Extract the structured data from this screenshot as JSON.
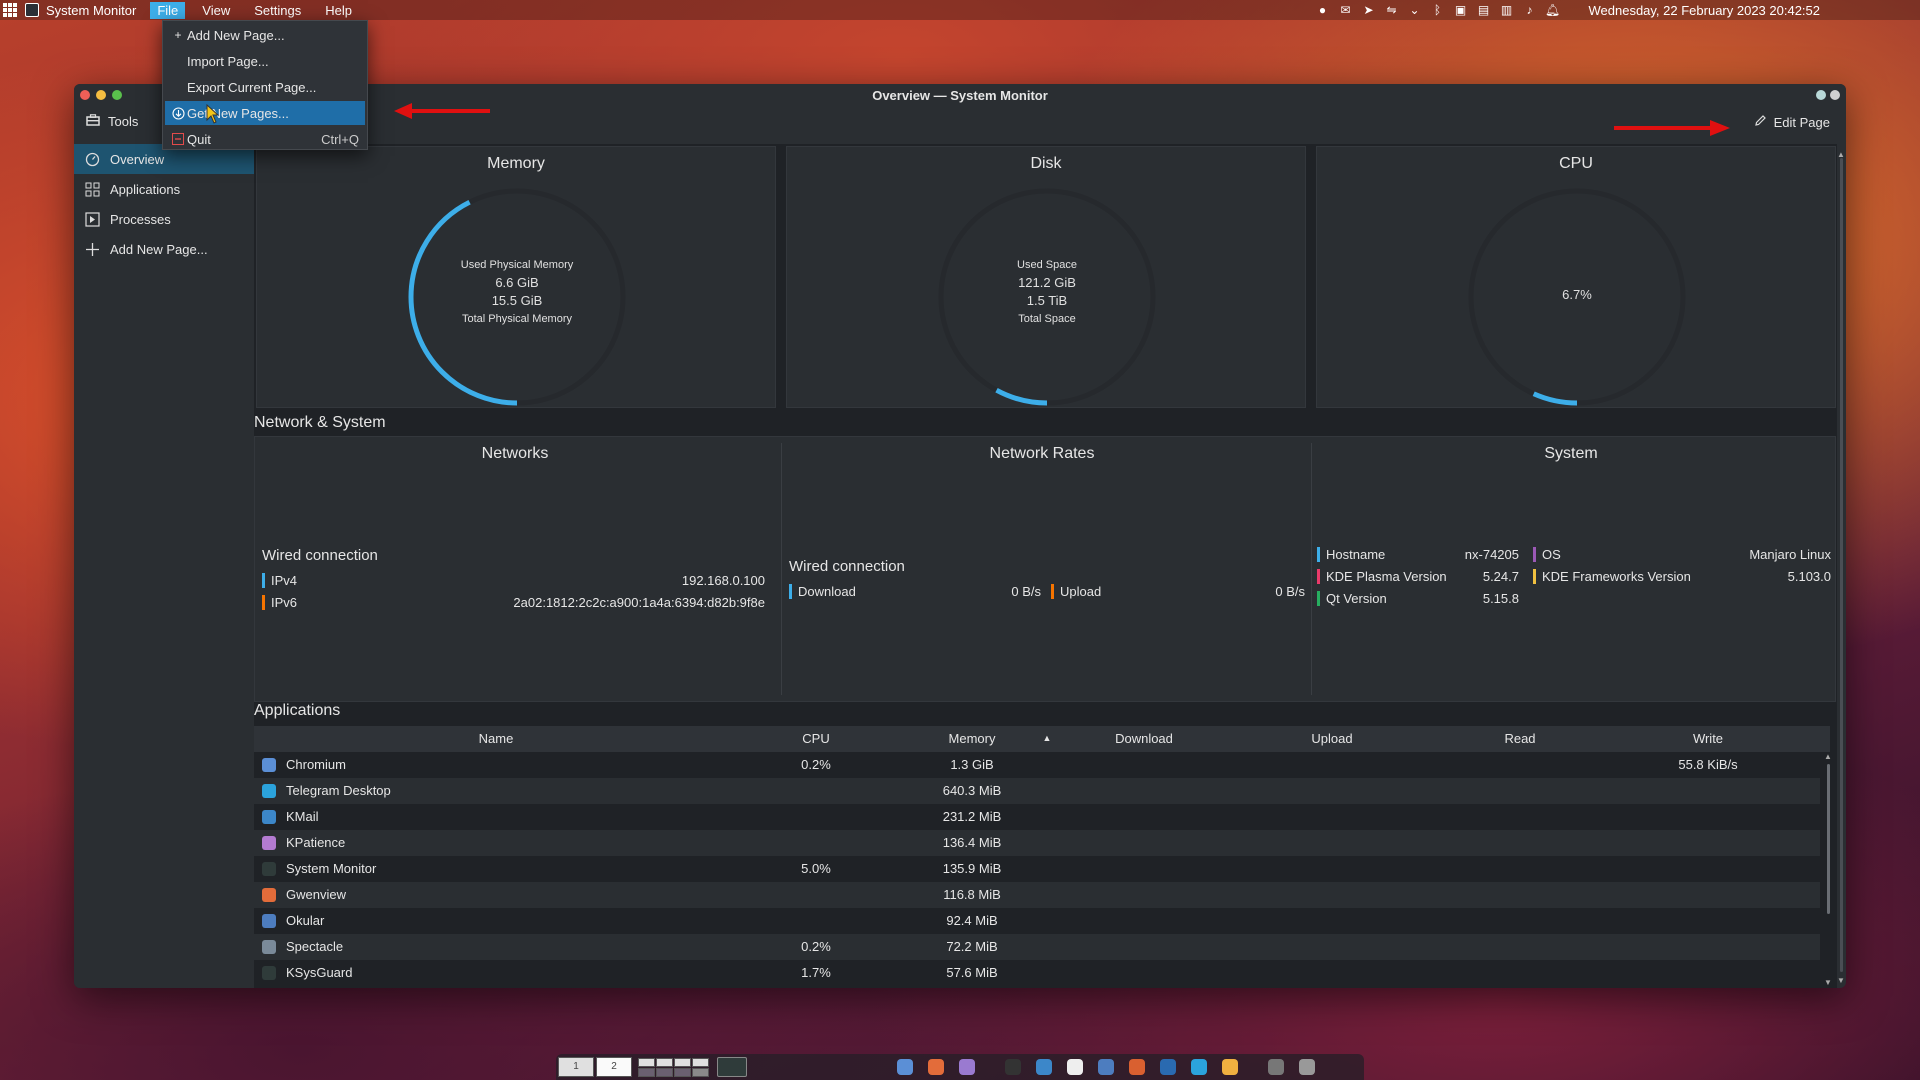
{
  "menubar": {
    "app_name": "System Monitor",
    "menus": [
      "File",
      "View",
      "Settings",
      "Help"
    ],
    "clock": "Wednesday, 22 February 2023  20:42:52"
  },
  "file_menu": {
    "items": [
      {
        "label": "Add New Page...",
        "icon": "plus-icon",
        "shortcut": ""
      },
      {
        "label": "Import Page...",
        "icon": "",
        "shortcut": ""
      },
      {
        "label": "Export Current Page...",
        "icon": "",
        "shortcut": ""
      },
      {
        "label": "Get New Pages...",
        "icon": "download-icon",
        "shortcut": ""
      },
      {
        "label": "Quit",
        "icon": "quit-icon",
        "shortcut": "Ctrl+Q"
      }
    ],
    "highlighted": "Get New Pages..."
  },
  "window": {
    "title": "Overview — System Monitor",
    "tools_label": "Tools",
    "edit_page_label": "Edit Page"
  },
  "sidebar": {
    "items": [
      {
        "label": "Overview",
        "icon": "overview-icon",
        "active": true
      },
      {
        "label": "Applications",
        "icon": "applications-icon",
        "active": false
      },
      {
        "label": "Processes",
        "icon": "processes-icon",
        "active": false
      },
      {
        "label": "Add New Page...",
        "icon": "plus-icon",
        "active": false
      }
    ]
  },
  "overview": {
    "memory": {
      "title": "Memory",
      "used_label": "Used Physical Memory",
      "used": "6.6 GiB",
      "total": "15.5 GiB",
      "total_label": "Total Physical Memory",
      "fraction": 0.426
    },
    "disk": {
      "title": "Disk",
      "used_label": "Used Space",
      "used": "121.2 GiB",
      "total": "1.5 TiB",
      "total_label": "Total Space",
      "fraction": 0.079
    },
    "cpu": {
      "title": "CPU",
      "value": "6.7%",
      "fraction": 0.067
    }
  },
  "network_system": {
    "section_title": "Network & System",
    "networks": {
      "title": "Networks",
      "connection": "Wired connection",
      "rows": [
        {
          "label": "IPv4",
          "value": "192.168.0.100",
          "color": "#3daee9"
        },
        {
          "label": "IPv6",
          "value": "2a02:1812:2c2c:a900:1a4a:6394:d82b:9f8e",
          "color": "#f67400"
        }
      ]
    },
    "rates": {
      "title": "Network Rates",
      "connection": "Wired connection",
      "download_label": "Download",
      "download_value": "0 B/s",
      "upload_label": "Upload",
      "upload_value": "0 B/s"
    },
    "system": {
      "title": "System",
      "left": [
        {
          "label": "Hostname",
          "value": "nx-74205",
          "color": "#3daee9"
        },
        {
          "label": "KDE Plasma Version",
          "value": "5.24.7",
          "color": "#e93a6a"
        },
        {
          "label": "Qt Version",
          "value": "5.15.8",
          "color": "#27ae60"
        }
      ],
      "right": [
        {
          "label": "OS",
          "value": "Manjaro Linux",
          "color": "#9b59b6"
        },
        {
          "label": "KDE Frameworks Version",
          "value": "5.103.0",
          "color": "#f0c040"
        }
      ]
    }
  },
  "applications": {
    "section_title": "Applications",
    "columns": [
      "Name",
      "CPU",
      "Memory",
      "Download",
      "Upload",
      "Read",
      "Write"
    ],
    "sort_indicator": "▲",
    "rows": [
      {
        "name": "Chromium",
        "cpu": "0.2%",
        "memory": "1.3 GiB",
        "write": "55.8 KiB/s",
        "icon_color": "#5b8fd6"
      },
      {
        "name": "Telegram Desktop",
        "cpu": "",
        "memory": "640.3 MiB",
        "write": "",
        "icon_color": "#2ba3dc"
      },
      {
        "name": "KMail",
        "cpu": "",
        "memory": "231.2 MiB",
        "write": "",
        "icon_color": "#3c87c9"
      },
      {
        "name": "KPatience",
        "cpu": "",
        "memory": "136.4 MiB",
        "write": "",
        "icon_color": "#b37bd1"
      },
      {
        "name": "System Monitor",
        "cpu": "5.0%",
        "memory": "135.9 MiB",
        "write": "",
        "icon_color": "#2f3b3a"
      },
      {
        "name": "Gwenview",
        "cpu": "",
        "memory": "116.8 MiB",
        "write": "",
        "icon_color": "#e36c3a"
      },
      {
        "name": "Okular",
        "cpu": "",
        "memory": "92.4 MiB",
        "write": "",
        "icon_color": "#4d7dbf"
      },
      {
        "name": "Spectacle",
        "cpu": "0.2%",
        "memory": "72.2 MiB",
        "write": "",
        "icon_color": "#7a8a99"
      },
      {
        "name": "KSysGuard",
        "cpu": "1.7%",
        "memory": "57.6 MiB",
        "write": "",
        "icon_color": "#2f3b3a"
      }
    ]
  },
  "dock": {
    "desktop_labels": [
      "1",
      "2"
    ]
  },
  "colors": {
    "accent": "#3daee9",
    "selection": "#1e5470",
    "annotation_arrow": "#e01010"
  }
}
